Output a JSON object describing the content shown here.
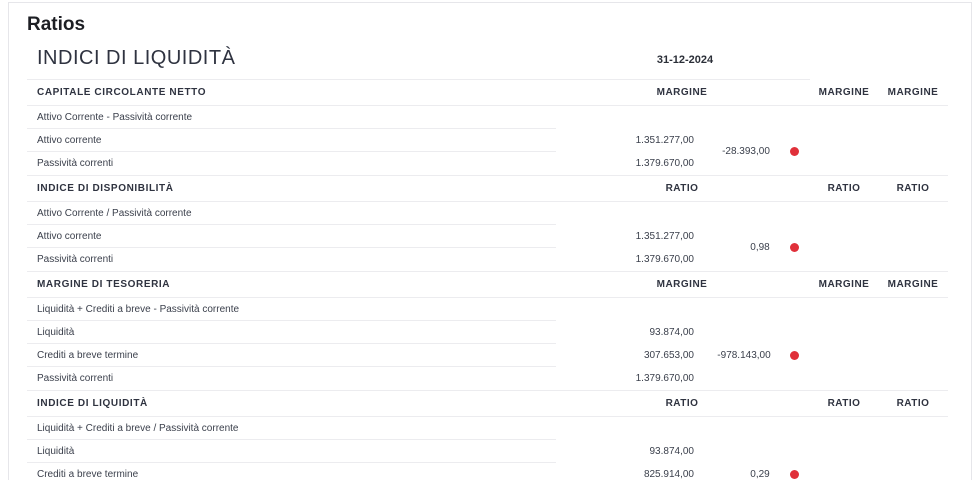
{
  "page_title": "Ratios",
  "sheet_title": "INDICI DI LIQUIDITÀ",
  "date": "31-12-2024",
  "status_color": "#e0303a",
  "sections": [
    {
      "heading": "CAPITALE CIRCOLANTE NETTO",
      "col_header": "MARGINE",
      "extra_header_1": "MARGINE",
      "extra_header_2": "MARGINE",
      "formula": "Attivo Corrente - Passività corrente",
      "lines": [
        {
          "label": "Attivo corrente",
          "value": "1.351.277,00"
        },
        {
          "label": "Passività correnti",
          "value": "1.379.670,00"
        }
      ],
      "result": "-28.393,00",
      "status": "red-dot-icon"
    },
    {
      "heading": "INDICE DI DISPONIBILITÀ",
      "col_header": "RATIO",
      "extra_header_1": "RATIO",
      "extra_header_2": "RATIO",
      "formula": "Attivo Corrente / Passività corrente",
      "lines": [
        {
          "label": "Attivo corrente",
          "value": "1.351.277,00"
        },
        {
          "label": "Passività correnti",
          "value": "1.379.670,00"
        }
      ],
      "result": "0,98",
      "status": "red-dot-icon"
    },
    {
      "heading": "MARGINE DI TESORERIA",
      "col_header": "MARGINE",
      "extra_header_1": "MARGINE",
      "extra_header_2": "MARGINE",
      "formula": "Liquidità + Crediti a breve - Passività corrente",
      "lines": [
        {
          "label": "Liquidità",
          "value": "93.874,00"
        },
        {
          "label": "Crediti a breve termine",
          "value": "307.653,00"
        },
        {
          "label": "Passività correnti",
          "value": "1.379.670,00"
        }
      ],
      "result": "-978.143,00",
      "status": "red-dot-icon"
    },
    {
      "heading": "INDICE DI LIQUIDITÀ",
      "col_header": "RATIO",
      "extra_header_1": "RATIO",
      "extra_header_2": "RATIO",
      "formula": "Liquidità + Crediti a breve / Passività corrente",
      "lines": [
        {
          "label": "Liquidità",
          "value": "93.874,00"
        },
        {
          "label": "Crediti a breve termine",
          "value": "825.914,00"
        }
      ],
      "result": "0,29",
      "status": "red-dot-icon"
    }
  ]
}
